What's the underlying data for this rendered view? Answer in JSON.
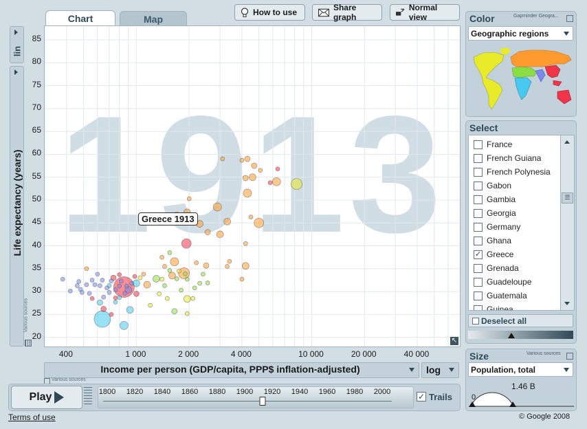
{
  "tabs": {
    "chart": "Chart",
    "map": "Map"
  },
  "toolbar": {
    "how_to_use": "How to use",
    "share_graph": "Share graph",
    "normal_view": "Normal view"
  },
  "yaxis": {
    "scale": "lin",
    "label": "Life expectancy (years)",
    "ticks": [
      "85",
      "80",
      "75",
      "70",
      "65",
      "60",
      "55",
      "50",
      "45",
      "40",
      "35",
      "30",
      "25",
      "20"
    ]
  },
  "xaxis": {
    "label": "Income per person (GDP/capita, PPP$ inflation-adjusted)",
    "scale": "log",
    "ticks": [
      "400",
      "1 000",
      "2 000",
      "4 000",
      "10 000",
      "20 000",
      "40 000"
    ]
  },
  "year": "1913",
  "tooltip": "Greece 1913",
  "various_sources": "Various sources",
  "color_panel": {
    "title": "Color",
    "source": "Gapminder Geogra...",
    "selected": "Geographic regions"
  },
  "select_panel": {
    "title": "Select",
    "items": [
      {
        "label": "France",
        "checked": false
      },
      {
        "label": "French Guiana",
        "checked": false
      },
      {
        "label": "French Polynesia",
        "checked": false
      },
      {
        "label": "Gabon",
        "checked": false
      },
      {
        "label": "Gambia",
        "checked": false
      },
      {
        "label": "Georgia",
        "checked": false
      },
      {
        "label": "Germany",
        "checked": false
      },
      {
        "label": "Ghana",
        "checked": false
      },
      {
        "label": "Greece",
        "checked": true
      },
      {
        "label": "Grenada",
        "checked": false
      },
      {
        "label": "Guadeloupe",
        "checked": false
      },
      {
        "label": "Guatemala",
        "checked": false
      },
      {
        "label": "Guinea",
        "checked": false
      }
    ],
    "deselect_all": "Deselect all"
  },
  "size_panel": {
    "title": "Size",
    "source": "Various sources",
    "selected": "Population, total",
    "max": "1.46 B",
    "min": "0"
  },
  "play": {
    "label": "Play",
    "trails": "Trails",
    "trails_checked": true,
    "timeline": [
      "1800",
      "1820",
      "1840",
      "1860",
      "1880",
      "1900",
      "1920",
      "1940",
      "1960",
      "1980",
      "2000"
    ],
    "current_year": 1913
  },
  "footer": {
    "terms": "Terms of use",
    "copyright": "© Google 2008"
  },
  "colors": {
    "americas": "#e8ea2a",
    "europe_central_asia": "#ff9a2e",
    "middle_east_north_africa": "#8cdd44",
    "sub_saharan_africa": "#47c8ee",
    "south_asia": "#7a8ae8",
    "east_asia_pacific": "#f0354a",
    "highlight": "#f45a4a"
  },
  "chart_data": {
    "type": "scatter",
    "xlabel": "Income per person (GDP/capita, PPP$ inflation-adjusted)",
    "ylabel": "Life expectancy (years)",
    "xscale": "log",
    "xlim": [
      300,
      70000
    ],
    "ylim": [
      18,
      88
    ],
    "year": 1913,
    "points": [
      {
        "x": 850,
        "y": 31,
        "r": 15,
        "c": "#f0354a"
      },
      {
        "x": 640,
        "y": 24,
        "r": 12,
        "c": "#47c8ee"
      },
      {
        "x": 2550,
        "y": 43,
        "r": 4,
        "c": "#ff9a2e"
      },
      {
        "x": 1930,
        "y": 40.5,
        "r": 7,
        "c": "#f0354a"
      },
      {
        "x": 1870,
        "y": 34,
        "r": 8,
        "c": "#ff9a2e"
      },
      {
        "x": 8200,
        "y": 53.5,
        "r": 8,
        "c": "#e8ea2a"
      },
      {
        "x": 5000,
        "y": 45,
        "r": 7,
        "c": "#ff9a2e"
      },
      {
        "x": 4300,
        "y": 51.5,
        "r": 6,
        "c": "#ff9a2e"
      },
      {
        "x": 2900,
        "y": 48.5,
        "r": 6,
        "c": "#ff9a2e"
      },
      {
        "x": 6300,
        "y": 54,
        "r": 6,
        "c": "#ff9a2e"
      },
      {
        "x": 4600,
        "y": 55,
        "r": 5,
        "c": "#ff9a2e"
      },
      {
        "x": 4700,
        "y": 57.5,
        "r": 4,
        "c": "#ff9a2e"
      },
      {
        "x": 4000,
        "y": 58.7,
        "r": 3,
        "c": "#ff9a2e"
      },
      {
        "x": 4300,
        "y": 59,
        "r": 4,
        "c": "#ff9a2e"
      },
      {
        "x": 3100,
        "y": 59,
        "r": 3,
        "c": "#ff9a2e"
      },
      {
        "x": 6400,
        "y": 56.8,
        "r": 3,
        "c": "#f0354a"
      },
      {
        "x": 5800,
        "y": 53.8,
        "r": 3,
        "c": "#f0354a"
      },
      {
        "x": 4200,
        "y": 54.8,
        "r": 4,
        "c": "#ff9a2e"
      },
      {
        "x": 5100,
        "y": 56.5,
        "r": 3,
        "c": "#ff9a2e"
      },
      {
        "x": 2000,
        "y": 50.3,
        "r": 3,
        "c": "#ff9a2e"
      },
      {
        "x": 1950,
        "y": 47.3,
        "r": 5,
        "c": "#ff9a2e"
      },
      {
        "x": 3300,
        "y": 45.3,
        "r": 5,
        "c": "#ff9a2e"
      },
      {
        "x": 4500,
        "y": 46.3,
        "r": 3,
        "c": "#ff9a2e"
      },
      {
        "x": 4200,
        "y": 40.5,
        "r": 3,
        "c": "#ff9a2e"
      },
      {
        "x": 2300,
        "y": 44.8,
        "r": 5,
        "c": "#ff9a2e"
      },
      {
        "x": 1700,
        "y": 46.5,
        "r": 6,
        "c": "#ff9a2e"
      },
      {
        "x": 3000,
        "y": 42.5,
        "r": 5,
        "c": "#ff9a2e"
      },
      {
        "x": 1650,
        "y": 36.5,
        "r": 6,
        "c": "#ff9a2e"
      },
      {
        "x": 1600,
        "y": 33.5,
        "r": 5,
        "c": "#ff9a2e"
      },
      {
        "x": 1450,
        "y": 35.5,
        "r": 3,
        "c": "#ff9a2e"
      },
      {
        "x": 2500,
        "y": 35.7,
        "r": 4,
        "c": "#ff9a2e"
      },
      {
        "x": 2200,
        "y": 36.3,
        "r": 3,
        "c": "#ff9a2e"
      },
      {
        "x": 3300,
        "y": 35.5,
        "r": 3,
        "c": "#ff9a2e"
      },
      {
        "x": 3400,
        "y": 36.6,
        "r": 3,
        "c": "#ff9a2e"
      },
      {
        "x": 4200,
        "y": 35.6,
        "r": 5,
        "c": "#ff9a2e"
      },
      {
        "x": 4000,
        "y": 32.7,
        "r": 3,
        "c": "#ff9a2e"
      },
      {
        "x": 1150,
        "y": 31.5,
        "r": 5,
        "c": "#ff9a2e"
      },
      {
        "x": 1100,
        "y": 33.8,
        "r": 3,
        "c": "#ff9a2e"
      },
      {
        "x": 1400,
        "y": 37.5,
        "r": 3,
        "c": "#ff9a2e"
      },
      {
        "x": 520,
        "y": 35,
        "r": 3,
        "c": "#ff9a2e"
      },
      {
        "x": 1550,
        "y": 38.5,
        "r": 3,
        "c": "#8cdd44"
      },
      {
        "x": 1300,
        "y": 32.8,
        "r": 5,
        "c": "#8cdd44"
      },
      {
        "x": 1450,
        "y": 31.3,
        "r": 3,
        "c": "#8cdd44"
      },
      {
        "x": 1550,
        "y": 34.6,
        "r": 3,
        "c": "#8cdd44"
      },
      {
        "x": 1700,
        "y": 32.8,
        "r": 3,
        "c": "#8cdd44"
      },
      {
        "x": 1900,
        "y": 33.9,
        "r": 3,
        "c": "#8cdd44"
      },
      {
        "x": 1800,
        "y": 30.3,
        "r": 3,
        "c": "#8cdd44"
      },
      {
        "x": 2150,
        "y": 30.8,
        "r": 3,
        "c": "#8cdd44"
      },
      {
        "x": 2300,
        "y": 31.8,
        "r": 3,
        "c": "#8cdd44"
      },
      {
        "x": 2550,
        "y": 31.9,
        "r": 3,
        "c": "#8cdd44"
      },
      {
        "x": 2400,
        "y": 33.8,
        "r": 3,
        "c": "#8cdd44"
      },
      {
        "x": 1950,
        "y": 32.7,
        "r": 3,
        "c": "#8cdd44"
      },
      {
        "x": 1650,
        "y": 25.7,
        "r": 4,
        "c": "#8cdd44"
      },
      {
        "x": 1950,
        "y": 28.4,
        "r": 5,
        "c": "#e8ea2a"
      },
      {
        "x": 2100,
        "y": 28.5,
        "r": 3,
        "c": "#e8ea2a"
      },
      {
        "x": 1950,
        "y": 25.2,
        "r": 3,
        "c": "#e8ea2a"
      },
      {
        "x": 1050,
        "y": 33,
        "r": 3,
        "c": "#e8ea2a"
      },
      {
        "x": 1200,
        "y": 27,
        "r": 3,
        "c": "#e8ea2a"
      },
      {
        "x": 1350,
        "y": 29.5,
        "r": 3,
        "c": "#e8ea2a"
      },
      {
        "x": 1500,
        "y": 28.5,
        "r": 3,
        "c": "#e8ea2a"
      },
      {
        "x": 1400,
        "y": 32.7,
        "r": 3,
        "c": "#e8ea2a"
      },
      {
        "x": 1750,
        "y": 34.5,
        "r": 3,
        "c": "#e8ea2a"
      },
      {
        "x": 920,
        "y": 26,
        "r": 5,
        "c": "#47c8ee"
      },
      {
        "x": 850,
        "y": 22.6,
        "r": 6,
        "c": "#47c8ee"
      },
      {
        "x": 620,
        "y": 27.6,
        "r": 4,
        "c": "#47c8ee"
      },
      {
        "x": 760,
        "y": 27.7,
        "r": 3,
        "c": "#47c8ee"
      },
      {
        "x": 700,
        "y": 31.3,
        "r": 3,
        "c": "#47c8ee"
      },
      {
        "x": 1000,
        "y": 31.8,
        "r": 5,
        "c": "#47c8ee"
      },
      {
        "x": 800,
        "y": 28.7,
        "r": 3,
        "c": "#47c8ee"
      },
      {
        "x": 480,
        "y": 30.5,
        "r": 3,
        "c": "#7a8ae8"
      },
      {
        "x": 460,
        "y": 31.3,
        "r": 3,
        "c": "#7a8ae8"
      },
      {
        "x": 420,
        "y": 30.1,
        "r": 3,
        "c": "#7a8ae8"
      },
      {
        "x": 490,
        "y": 29.8,
        "r": 3,
        "c": "#7a8ae8"
      },
      {
        "x": 540,
        "y": 29.6,
        "r": 3,
        "c": "#7a8ae8"
      },
      {
        "x": 560,
        "y": 32.5,
        "r": 3,
        "c": "#7a8ae8"
      },
      {
        "x": 580,
        "y": 31.5,
        "r": 3,
        "c": "#7a8ae8"
      },
      {
        "x": 600,
        "y": 33.8,
        "r": 3,
        "c": "#7a8ae8"
      },
      {
        "x": 620,
        "y": 31.3,
        "r": 3,
        "c": "#7a8ae8"
      },
      {
        "x": 640,
        "y": 32.5,
        "r": 3,
        "c": "#7a8ae8"
      },
      {
        "x": 680,
        "y": 30.8,
        "r": 3,
        "c": "#7a8ae8"
      },
      {
        "x": 720,
        "y": 32.3,
        "r": 3,
        "c": "#7a8ae8"
      },
      {
        "x": 760,
        "y": 30.4,
        "r": 3,
        "c": "#7a8ae8"
      },
      {
        "x": 800,
        "y": 31.2,
        "r": 3,
        "c": "#7a8ae8"
      },
      {
        "x": 820,
        "y": 32.3,
        "r": 3,
        "c": "#7a8ae8"
      },
      {
        "x": 860,
        "y": 29.6,
        "r": 3,
        "c": "#7a8ae8"
      },
      {
        "x": 880,
        "y": 31.2,
        "r": 3,
        "c": "#7a8ae8"
      },
      {
        "x": 900,
        "y": 30.4,
        "r": 5,
        "c": "#7a8ae8"
      },
      {
        "x": 940,
        "y": 31.8,
        "r": 3,
        "c": "#7a8ae8"
      },
      {
        "x": 700,
        "y": 29.8,
        "r": 3,
        "c": "#7a8ae8"
      },
      {
        "x": 650,
        "y": 28.8,
        "r": 3,
        "c": "#7a8ae8"
      },
      {
        "x": 520,
        "y": 31.5,
        "r": 3,
        "c": "#7a8ae8"
      },
      {
        "x": 470,
        "y": 32.2,
        "r": 3,
        "c": "#7a8ae8"
      },
      {
        "x": 380,
        "y": 32.7,
        "r": 3,
        "c": "#7a8ae8"
      },
      {
        "x": 760,
        "y": 28.6,
        "r": 3,
        "c": "#f0354a"
      },
      {
        "x": 650,
        "y": 26.2,
        "r": 4,
        "c": "#f0354a"
      },
      {
        "x": 560,
        "y": 28.5,
        "r": 3,
        "c": "#f0354a"
      },
      {
        "x": 740,
        "y": 33,
        "r": 4,
        "c": "#f0354a"
      },
      {
        "x": 1000,
        "y": 29.5,
        "r": 4,
        "c": "#f0354a"
      },
      {
        "x": 980,
        "y": 33.3,
        "r": 3,
        "c": "#f0354a"
      },
      {
        "x": 800,
        "y": 33.7,
        "r": 3,
        "c": "#f0354a"
      },
      {
        "x": 720,
        "y": 25,
        "r": 3,
        "c": "#f0354a"
      }
    ]
  }
}
